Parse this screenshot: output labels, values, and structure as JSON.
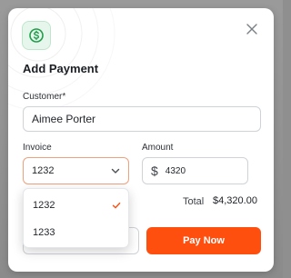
{
  "modal": {
    "title": "Add Payment",
    "icon": "dollar-circle-icon",
    "close_icon": "close-icon"
  },
  "form": {
    "customer": {
      "label": "Customer*",
      "value": "Aimee Porter"
    },
    "invoice": {
      "label": "Invoice",
      "selected": "1232",
      "options": [
        {
          "label": "1232",
          "checked": true
        },
        {
          "label": "1233",
          "checked": false
        }
      ]
    },
    "amount": {
      "label": "Amount",
      "currency_symbol": "$",
      "value": "4320"
    },
    "total": {
      "label": "Total",
      "value": "$4,320.00"
    }
  },
  "actions": {
    "pay_label": "Pay Now"
  },
  "colors": {
    "accent": "#ff4f0f",
    "icon_green": "#1f9e4a",
    "focus_border": "#f1a07e"
  }
}
